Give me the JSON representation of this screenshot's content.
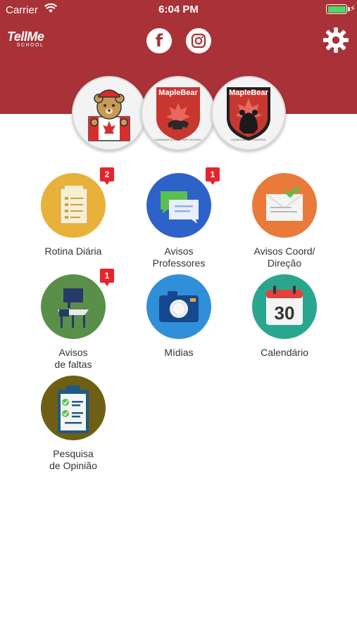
{
  "status_bar": {
    "carrier": "Carrier",
    "time": "6:04 PM"
  },
  "header": {
    "logo_title": "TellMe",
    "logo_subtitle": "SCHOOL",
    "social": [
      "facebook-icon",
      "instagram-icon"
    ],
    "settings": "gear-icon",
    "color": "#a83237"
  },
  "schools": [
    {
      "icon": "bear-mascot-canada-flag",
      "name": "",
      "caption": ""
    },
    {
      "icon": "maple-bear-elementary-logo",
      "name": "MapleBear",
      "caption": "CANADIAN ELEMENTARY SCHOOL"
    },
    {
      "icon": "maple-bear-high-school-logo",
      "name": "MapleBear",
      "caption": "CANADIAN HIGH SCHOOL"
    }
  ],
  "tiles": [
    {
      "label_line1": "Rotina Diária",
      "label_line2": "",
      "badge": "2",
      "icon": "clipboard-checklist-icon",
      "color": "#e8b23a"
    },
    {
      "label_line1": "Avisos",
      "label_line2": "Professores",
      "badge": "1",
      "icon": "chat-bubbles-icon",
      "color": "#2d62c8"
    },
    {
      "label_line1": "Avisos Coord/",
      "label_line2": "Direção",
      "badge": "",
      "icon": "envelope-check-icon",
      "color": "#ea7a3a"
    },
    {
      "label_line1": "Avisos",
      "label_line2": "de faltas",
      "badge": "1",
      "icon": "school-desk-icon",
      "color": "#5a8f4a"
    },
    {
      "label_line1": "Mídias",
      "label_line2": "",
      "badge": "",
      "icon": "camera-icon",
      "color": "#2f8fd8"
    },
    {
      "label_line1": "Calendário",
      "label_line2": "",
      "badge": "",
      "icon": "calendar-30-icon",
      "color": "#2aa68f",
      "day": "30"
    },
    {
      "label_line1": "Pesquisa",
      "label_line2": "de Opinião",
      "badge": "",
      "icon": "survey-clipboard-icon",
      "color": "#6e5f14"
    }
  ]
}
